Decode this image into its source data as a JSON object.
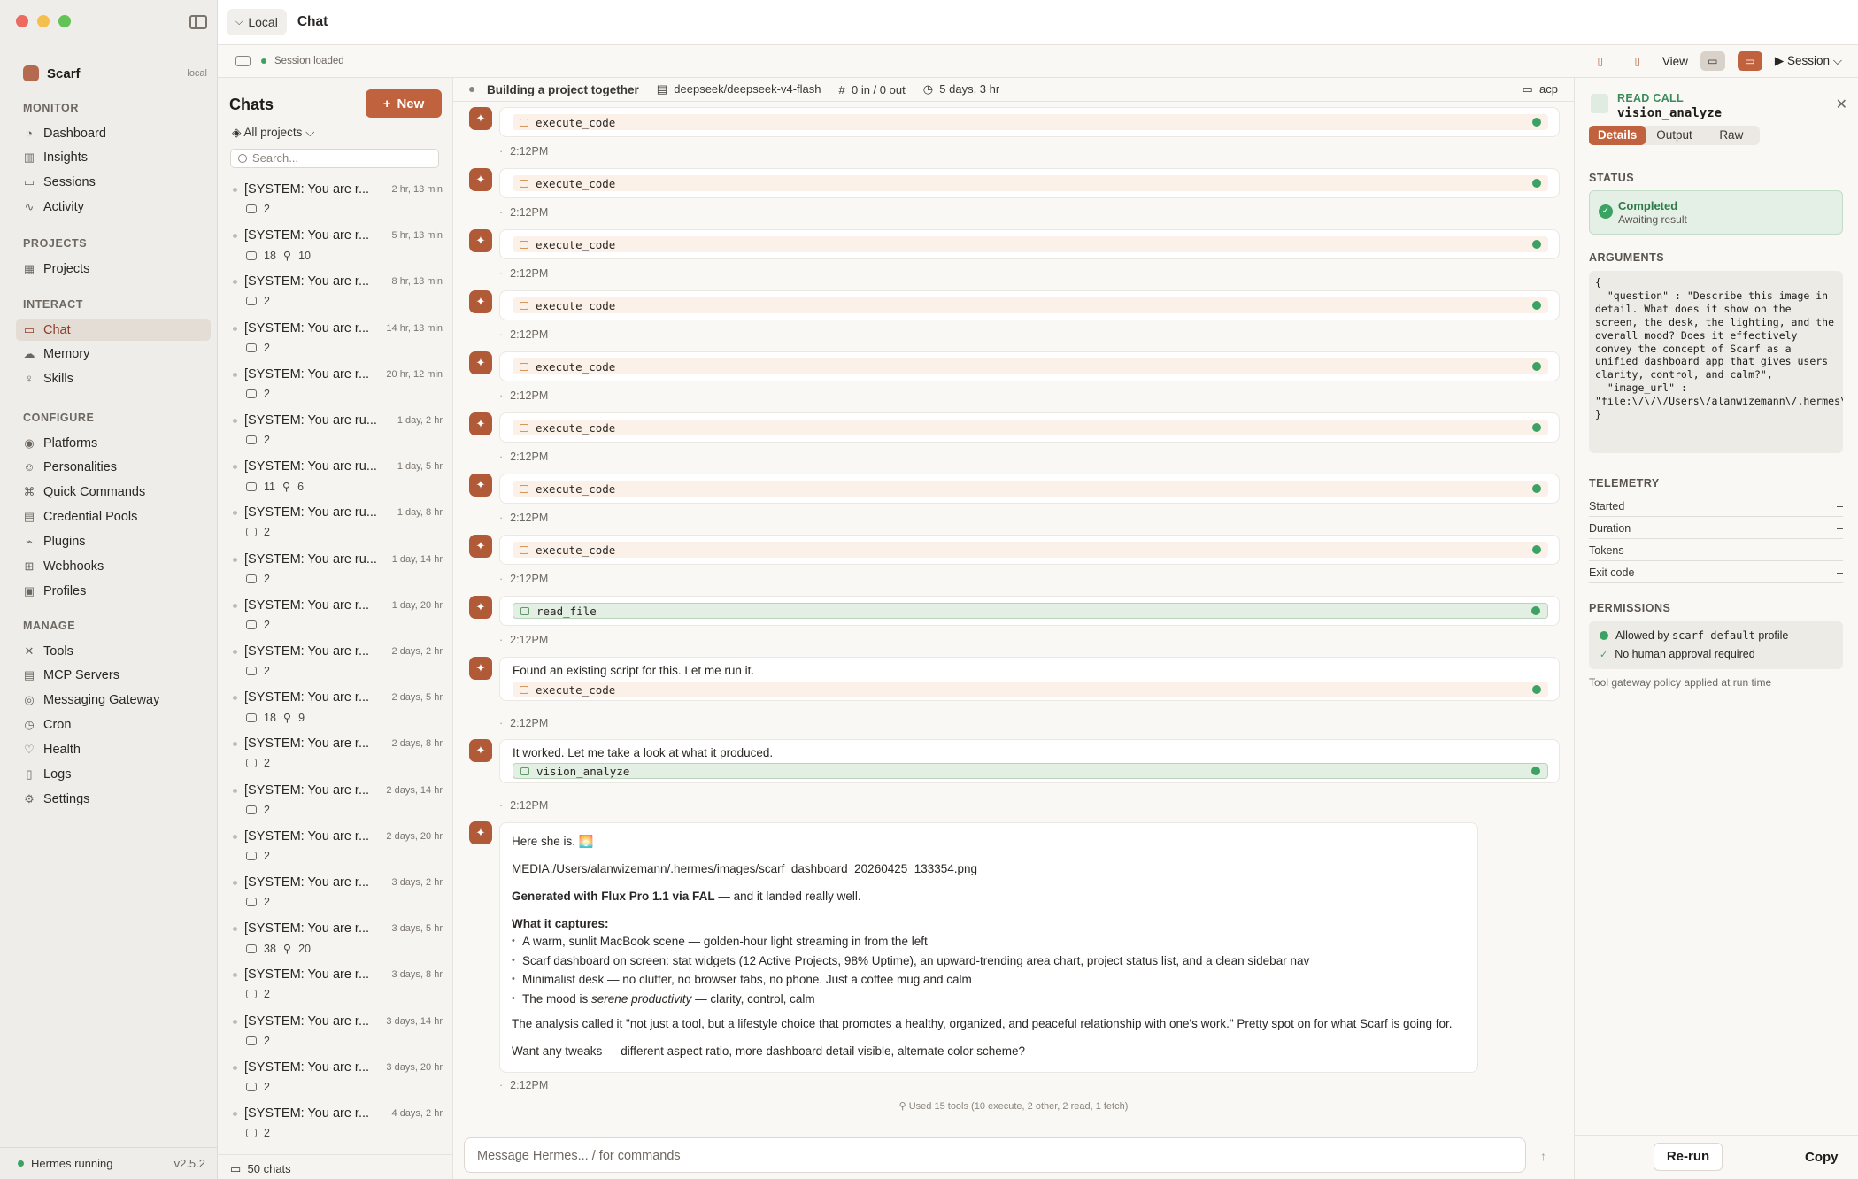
{
  "sidebar": {
    "app_name": "Scarf",
    "app_tag": "local",
    "sections": [
      {
        "title": "MONITOR",
        "items": [
          {
            "label": "Dashboard",
            "icon": "dashboard-icon"
          },
          {
            "label": "Insights",
            "icon": "bar-chart-icon"
          },
          {
            "label": "Sessions",
            "icon": "chat-bubbles-icon"
          },
          {
            "label": "Activity",
            "icon": "activity-icon"
          }
        ]
      },
      {
        "title": "PROJECTS",
        "items": [
          {
            "label": "Projects",
            "icon": "grid-icon"
          }
        ]
      },
      {
        "title": "INTERACT",
        "items": [
          {
            "label": "Chat",
            "icon": "chat-icon",
            "active": true
          },
          {
            "label": "Memory",
            "icon": "brain-icon"
          },
          {
            "label": "Skills",
            "icon": "lightbulb-icon"
          }
        ]
      },
      {
        "title": "CONFIGURE",
        "items": [
          {
            "label": "Platforms",
            "icon": "antenna-icon"
          },
          {
            "label": "Personalities",
            "icon": "people-icon"
          },
          {
            "label": "Quick Commands",
            "icon": "command-icon"
          },
          {
            "label": "Credential Pools",
            "icon": "key-icon"
          },
          {
            "label": "Plugins",
            "icon": "plug-icon"
          },
          {
            "label": "Webhooks",
            "icon": "webhook-icon"
          },
          {
            "label": "Profiles",
            "icon": "profile-icon"
          }
        ]
      },
      {
        "title": "MANAGE",
        "items": [
          {
            "label": "Tools",
            "icon": "tools-icon"
          },
          {
            "label": "MCP Servers",
            "icon": "server-icon"
          },
          {
            "label": "Messaging Gateway",
            "icon": "gateway-icon"
          },
          {
            "label": "Cron",
            "icon": "clock-icon"
          },
          {
            "label": "Health",
            "icon": "heart-icon"
          },
          {
            "label": "Logs",
            "icon": "doc-icon"
          },
          {
            "label": "Settings",
            "icon": "gear-icon"
          }
        ]
      }
    ],
    "status": "Hermes running",
    "version": "v2.5.2"
  },
  "topbar": {
    "location": "Local",
    "title": "Chat",
    "session_status": "Session loaded",
    "view_label": "View",
    "session_label": "Session"
  },
  "chats": {
    "title": "Chats",
    "new_label": "New",
    "filter": "All projects",
    "search_placeholder": "Search...",
    "footer": "50 chats",
    "items": [
      {
        "title": "[SYSTEM: You are r...",
        "time": "2 hr, 13 min",
        "msgs": "2",
        "tools": ""
      },
      {
        "title": "[SYSTEM: You are r...",
        "time": "5 hr, 13 min",
        "msgs": "18",
        "tools": "10"
      },
      {
        "title": "[SYSTEM: You are r...",
        "time": "8 hr, 13 min",
        "msgs": "2",
        "tools": ""
      },
      {
        "title": "[SYSTEM: You are r...",
        "time": "14 hr, 13 min",
        "msgs": "2",
        "tools": ""
      },
      {
        "title": "[SYSTEM: You are r...",
        "time": "20 hr, 12 min",
        "msgs": "2",
        "tools": ""
      },
      {
        "title": "[SYSTEM: You are ru...",
        "time": "1 day, 2 hr",
        "msgs": "2",
        "tools": ""
      },
      {
        "title": "[SYSTEM: You are ru...",
        "time": "1 day, 5 hr",
        "msgs": "11",
        "tools": "6"
      },
      {
        "title": "[SYSTEM: You are ru...",
        "time": "1 day, 8 hr",
        "msgs": "2",
        "tools": ""
      },
      {
        "title": "[SYSTEM: You are ru...",
        "time": "1 day, 14 hr",
        "msgs": "2",
        "tools": ""
      },
      {
        "title": "[SYSTEM: You are r...",
        "time": "1 day, 20 hr",
        "msgs": "2",
        "tools": ""
      },
      {
        "title": "[SYSTEM: You are r...",
        "time": "2 days, 2 hr",
        "msgs": "2",
        "tools": ""
      },
      {
        "title": "[SYSTEM: You are r...",
        "time": "2 days, 5 hr",
        "msgs": "18",
        "tools": "9"
      },
      {
        "title": "[SYSTEM: You are r...",
        "time": "2 days, 8 hr",
        "msgs": "2",
        "tools": ""
      },
      {
        "title": "[SYSTEM: You are r...",
        "time": "2 days, 14 hr",
        "msgs": "2",
        "tools": ""
      },
      {
        "title": "[SYSTEM: You are r...",
        "time": "2 days, 20 hr",
        "msgs": "2",
        "tools": ""
      },
      {
        "title": "[SYSTEM: You are r...",
        "time": "3 days, 2 hr",
        "msgs": "2",
        "tools": ""
      },
      {
        "title": "[SYSTEM: You are r...",
        "time": "3 days, 5 hr",
        "msgs": "38",
        "tools": "20"
      },
      {
        "title": "[SYSTEM: You are r...",
        "time": "3 days, 8 hr",
        "msgs": "2",
        "tools": ""
      },
      {
        "title": "[SYSTEM: You are r...",
        "time": "3 days, 14 hr",
        "msgs": "2",
        "tools": ""
      },
      {
        "title": "[SYSTEM: You are r...",
        "time": "3 days, 20 hr",
        "msgs": "2",
        "tools": ""
      },
      {
        "title": "[SYSTEM: You are r...",
        "time": "4 days, 2 hr",
        "msgs": "2",
        "tools": ""
      }
    ]
  },
  "conversation": {
    "title": "Building a project together",
    "model": "deepseek/deepseek-v4-flash",
    "tokens": "0 in / 0 out",
    "age": "5 days, 3 hr",
    "channel": "acp",
    "time": "2:12PM",
    "tool_calls": [
      "execute_code",
      "execute_code",
      "execute_code",
      "execute_code",
      "execute_code",
      "execute_code",
      "execute_code",
      "execute_code",
      "read_file"
    ],
    "msg1_text": "Found an existing script for this. Let me run it.",
    "msg1_tool": "execute_code",
    "msg2_text": "It worked. Let me take a look at what it produced.",
    "msg2_tool": "vision_analyze",
    "final": {
      "greeting": "Here she is. 🌅",
      "media": "MEDIA:/Users/alanwizemann/.hermes/images/scarf_dashboard_20260425_133354.png",
      "gen_bold": "Generated with Flux Pro 1.1 via FAL",
      "gen_rest": " — and it landed really well.",
      "captures_title": "What it captures:",
      "bullets": [
        "A warm, sunlit MacBook scene — golden-hour light streaming in from the left",
        "Scarf dashboard on screen: stat widgets (12 Active Projects, 98% Uptime), an upward-trending area chart, project status list, and a clean sidebar nav",
        "Minimalist desk — no clutter, no browser tabs, no phone. Just a coffee mug and calm"
      ],
      "mood_pre": "The mood is ",
      "mood_em": "serene productivity",
      "mood_post": " — clarity, control, calm",
      "analysis": "The analysis called it \"not just a tool, but a lifestyle choice that promotes a healthy, organized, and peaceful relationship with one's work.\" Pretty spot on for what Scarf is going for.",
      "tweaks": "Want any tweaks — different aspect ratio, more dashboard detail visible, alternate color scheme?"
    },
    "used_tools": "Used 15 tools (10 execute, 2 other, 2 read, 1 fetch)",
    "composer_placeholder": "Message Hermes...  /  for commands"
  },
  "inspector": {
    "kind": "READ CALL",
    "name": "vision_analyze",
    "tabs": [
      "Details",
      "Output",
      "Raw"
    ],
    "status_title": "STATUS",
    "status_main": "Completed",
    "status_sub": "Awaiting result",
    "args_title": "ARGUMENTS",
    "args": "{\n  \"question\" : \"Describe this image in detail. What does it show on the screen, the desk, the lighting, and the overall mood? Does it effectively convey the concept of Scarf as a unified dashboard app that gives users clarity, control, and calm?\",\n  \"image_url\" : \"file:\\/\\/\\/Users\\/alanwizemann\\/.hermes\\/images\\/scarf_dashboard_20260425_133354.png\"\n}",
    "telemetry_title": "TELEMETRY",
    "telemetry": [
      {
        "k": "Started",
        "v": "–"
      },
      {
        "k": "Duration",
        "v": "–"
      },
      {
        "k": "Tokens",
        "v": "–"
      },
      {
        "k": "Exit code",
        "v": "–"
      }
    ],
    "perm_title": "PERMISSIONS",
    "perm1_pre": "Allowed by ",
    "perm1_code": "scarf-default",
    "perm1_post": " profile",
    "perm2": "No human approval required",
    "policy": "Tool gateway policy applied at run time",
    "rerun": "Re-run",
    "copy": "Copy"
  },
  "colors": {
    "accent": "#c1623f",
    "success": "#3ba264"
  }
}
